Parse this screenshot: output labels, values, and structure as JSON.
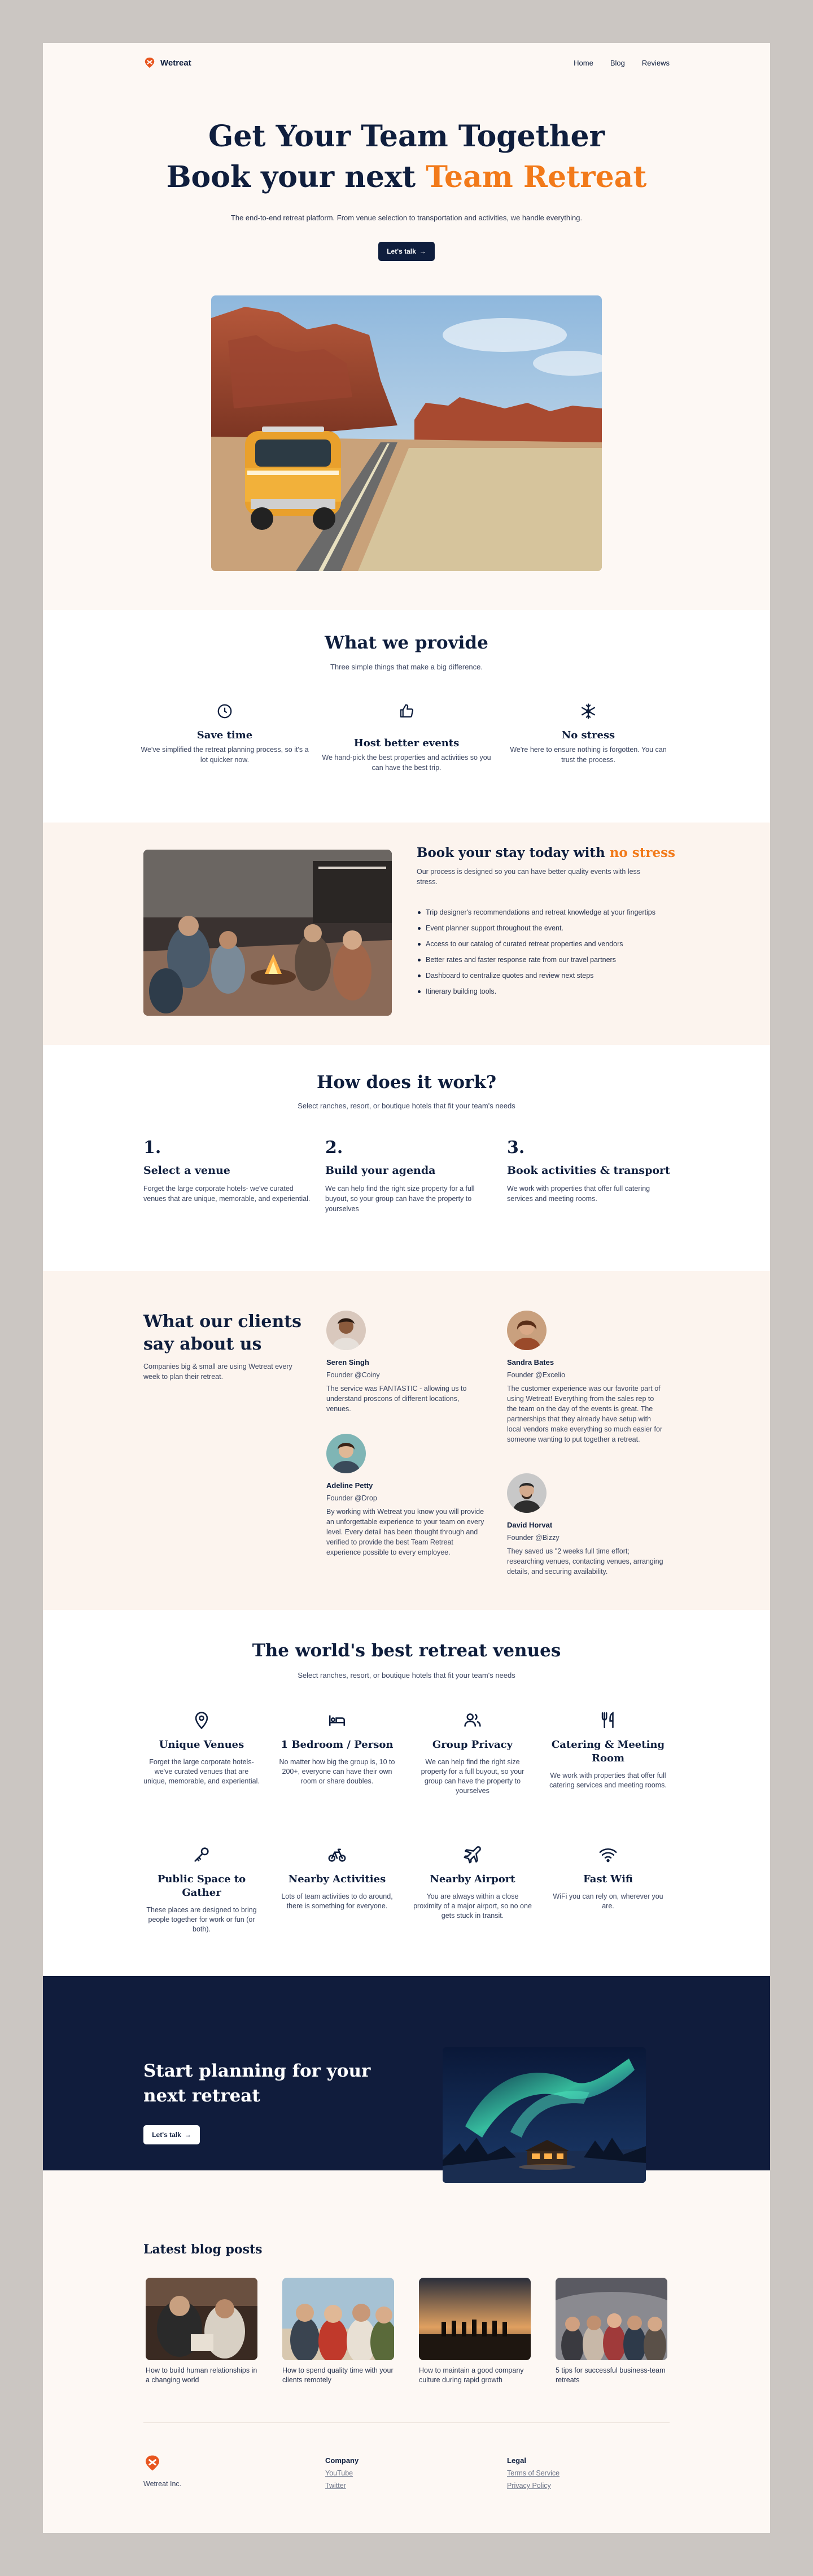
{
  "nav": {
    "brand": "Wetreat",
    "links": [
      "Home",
      "Blog",
      "Reviews"
    ]
  },
  "hero": {
    "line1": "Get Your Team Together",
    "line2_lead": "Book your next ",
    "line2_accent": "Team Retreat",
    "subtitle": "The end-to-end retreat platform. From venue selection to transportation and activities, we handle everything.",
    "cta": "Let's talk",
    "cta_arrow": "→"
  },
  "provide": {
    "title": "What we provide",
    "subtitle": "Three simple things that make a big difference.",
    "items": [
      {
        "title": "Save time",
        "text": "We've simplified the retreat planning process, so it's a lot quicker now.",
        "icon": "clock-icon"
      },
      {
        "title": "Host better events",
        "text": "We hand-pick the best properties and activities so you can have the best trip.",
        "icon": "thumbs-up-icon"
      },
      {
        "title": "No stress",
        "text": "We're here to ensure nothing is forgotten. You can trust the process.",
        "icon": "snowflake-icon"
      }
    ]
  },
  "book": {
    "title_lead": "Book your stay today with ",
    "title_accent": "no stress",
    "subtitle": "Our process is designed so you can have better quality events with less stress.",
    "bullets": [
      "Trip designer's recommendations and retreat knowledge at your fingertips",
      "Event planner support throughout the event.",
      "Access to our catalog of curated retreat properties and vendors",
      "Better rates and faster response rate from our travel partners",
      "Dashboard to centralize quotes and review next steps",
      "Itinerary building tools."
    ]
  },
  "how": {
    "title": "How does it work?",
    "subtitle": "Select ranches, resort, or boutique hotels that fit your team's needs",
    "steps": [
      {
        "num": "1.",
        "title": "Select a venue",
        "text": "Forget the large corporate hotels- we've curated venues that are unique, memorable, and experiential."
      },
      {
        "num": "2.",
        "title": "Build your agenda",
        "text": "We can help find the right size property for a full buyout, so your group can have the property to yourselves"
      },
      {
        "num": "3.",
        "title": "Book activities & transport",
        "text": "We work with properties that offer full catering services and meeting rooms."
      }
    ]
  },
  "testimonials": {
    "title": "What our clients say about us",
    "subtitle": "Companies big & small are using Wetreat every week to plan their retreat.",
    "items": [
      {
        "name": "Seren Singh",
        "role": "Founder @Coiny",
        "text": "The service was FANTASTIC - allowing us to understand proscons of different locations, venues."
      },
      {
        "name": "Sandra Bates",
        "role": "Founder @Excelio",
        "text": "The customer experience was our favorite part of using Wetreat! Everything from the sales rep to the team on the day of the events is great. The partnerships that they already have setup with local vendors make everything so much easier for someone wanting to put together a retreat."
      },
      {
        "name": "Adeline Petty",
        "role": "Founder @Drop",
        "text": "By working with Wetreat you know you will provide an unforgettable experience to your team on every level. Every detail has been thought through and verified to provide the best Team Retreat experience possible to every employee."
      },
      {
        "name": "David Horvat",
        "role": "Founder @Bizzy",
        "text": "They saved us \"2 weeks full time effort; researching venues, contacting venues, arranging details, and securing availability."
      }
    ]
  },
  "venues": {
    "title": "The world's best retreat venues",
    "subtitle": "Select ranches, resort, or boutique hotels that fit your team's needs",
    "items": [
      {
        "title": "Unique Venues",
        "text": "Forget the large corporate hotels- we've curated venues that are unique, memorable, and experiential.",
        "icon": "map-pin-icon"
      },
      {
        "title": "1 Bedroom / Person",
        "text": "No matter how big the group is, 10 to 200+, everyone can have their own room or share doubles.",
        "icon": "bed-icon"
      },
      {
        "title": "Group Privacy",
        "text": "We can help find the right size property for a full buyout, so your group can have the property to yourselves",
        "icon": "users-icon"
      },
      {
        "title": "Catering & Meeting Room",
        "text": "We work with properties that offer full catering services and meeting rooms.",
        "icon": "utensils-icon"
      },
      {
        "title": "Public Space to Gather",
        "text": "These places are designed to bring people together for work or fun (or both).",
        "icon": "key-icon"
      },
      {
        "title": "Nearby Activities",
        "text": "Lots of team activities to do around, there is something for everyone.",
        "icon": "bike-icon"
      },
      {
        "title": "Nearby Airport",
        "text": "You are always within a close proximity of a major airport, so no one gets stuck in transit.",
        "icon": "plane-icon"
      },
      {
        "title": "Fast Wifi",
        "text": "WiFi you can rely on, wherever you are.",
        "icon": "wifi-icon"
      }
    ]
  },
  "cta": {
    "title": "Start planning for your next retreat",
    "button": "Let's talk",
    "arrow": "→"
  },
  "blog": {
    "title": "Latest blog posts",
    "posts": [
      "How to build human relationships in a changing world",
      "How to spend quality time with your clients remotely",
      "How to maintain a good company culture during rapid growth",
      "5 tips for successful business-team retreats"
    ]
  },
  "footer": {
    "copyright": "Wetreat Inc.",
    "company_heading": "Company",
    "company_links": [
      "YouTube",
      "Twitter"
    ],
    "legal_heading": "Legal",
    "legal_links": [
      "Terms of Service",
      "Privacy Policy"
    ]
  },
  "colors": {
    "navy": "#0f1e3d",
    "accent": "#f27a1a",
    "cream": "#fcf4ee",
    "frame": "#cbc6c2"
  }
}
